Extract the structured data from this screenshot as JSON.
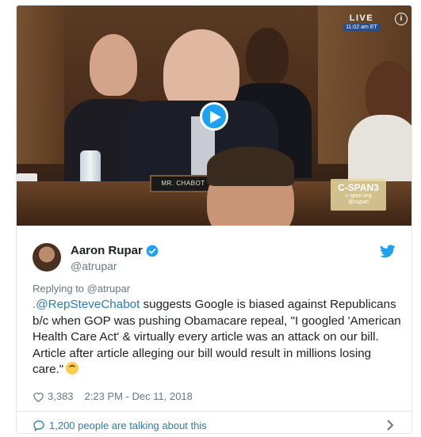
{
  "video": {
    "live_label": "LIVE",
    "live_time": "11:02 am ET",
    "nameplate": "MR. CHABOT",
    "network": "C-SPAN3",
    "network_site_1": "c-span.org",
    "network_site_2": "@cspan"
  },
  "tweet": {
    "author_name": "Aaron Rupar",
    "author_handle": "@atrupar",
    "replying_prefix": "Replying to ",
    "replying_to": "@atrupar",
    "text_mention": ".@RepSteveChabot",
    "text_body": " suggests Google is biased against Republicans b/c when GOP was pushing Obamacare repeal, \"I googled 'American Health Care Act' & virtually every article was an attack on our bill. Article after article alleging our bill would result in millions losing care.\"",
    "likes": "3,383",
    "timestamp": "2:23 PM - Dec 11, 2018",
    "talking": "1,200 people are talking about this"
  },
  "icons": {
    "play": "play-icon",
    "info": "info-icon",
    "verified": "verified-badge-icon",
    "bird": "twitter-bird-icon",
    "heart": "heart-icon",
    "comment": "comment-bubble-icon",
    "chevron": "chevron-right-icon",
    "emoji": "upside-down-face-emoji-icon"
  },
  "colors": {
    "accent": "#1da1f2",
    "link": "#2b7bb9",
    "muted": "#697882"
  }
}
